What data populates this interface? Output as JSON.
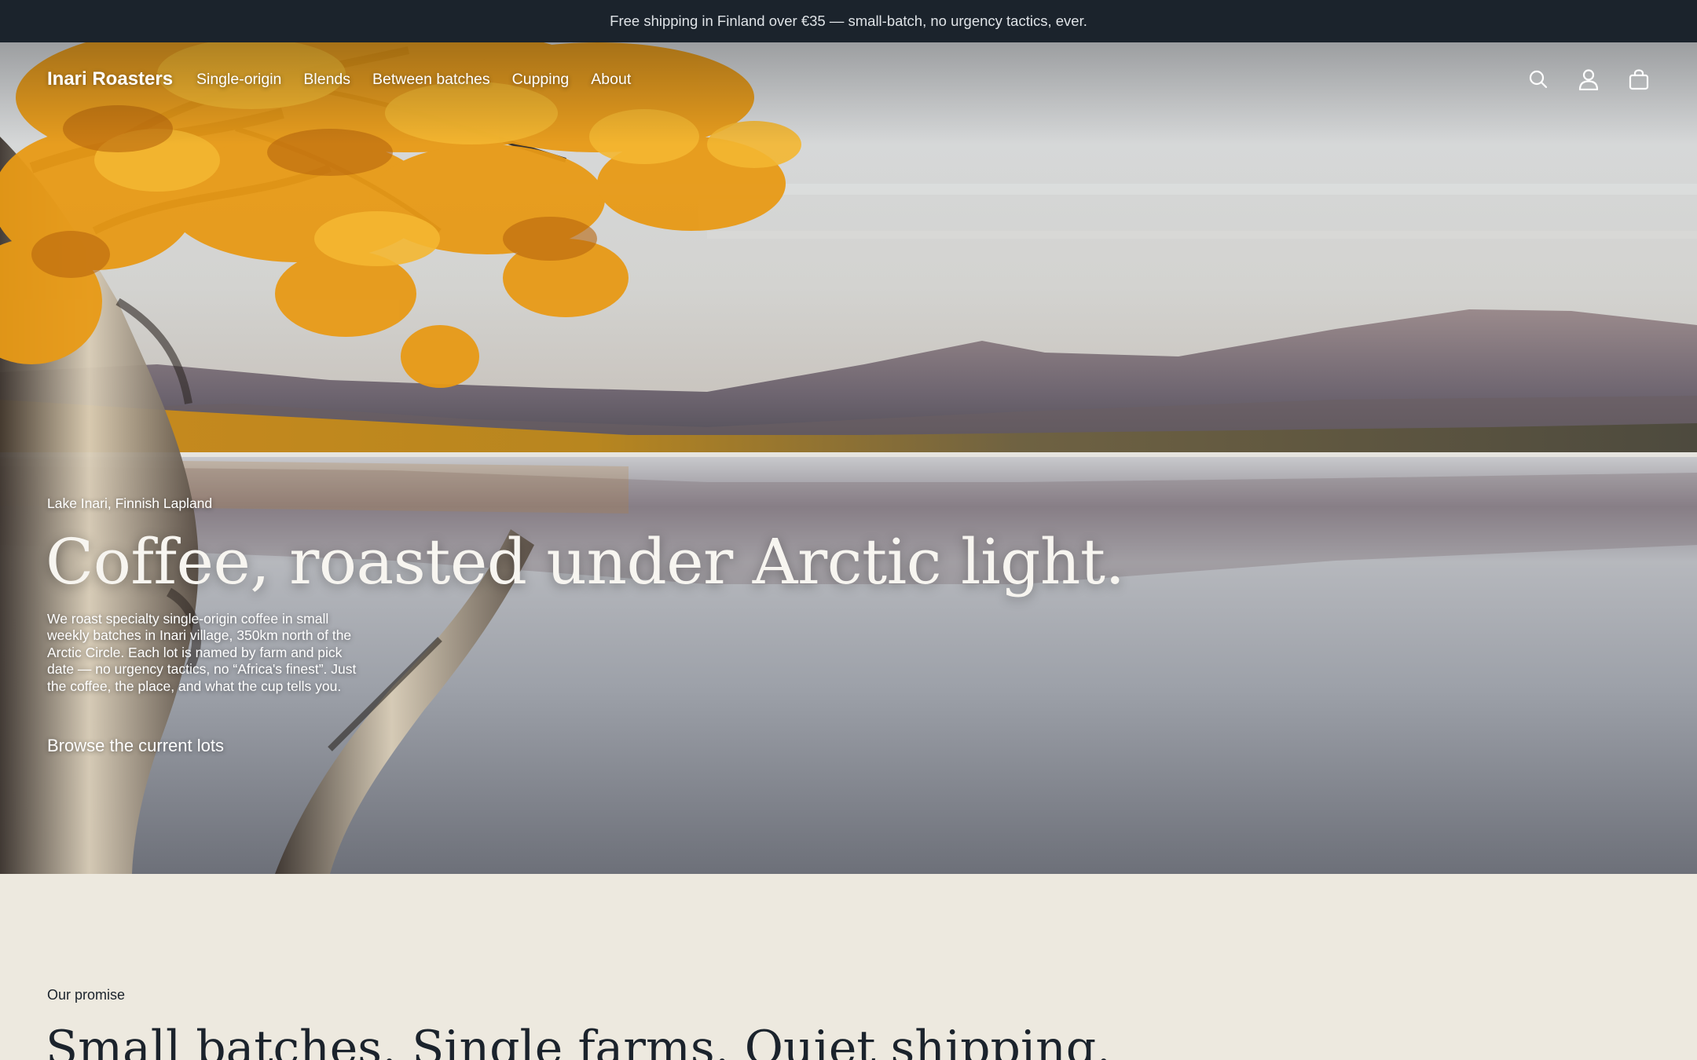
{
  "announcement": {
    "text": "Free shipping in Finland over €35 — small-batch, no urgency tactics, ever."
  },
  "header": {
    "brand": "Inari Roasters",
    "nav": [
      "Single-origin",
      "Blends",
      "Between batches",
      "Cupping",
      "About"
    ],
    "icons": [
      "search-icon",
      "account-icon",
      "cart-icon"
    ]
  },
  "hero": {
    "eyebrow": "Lake Inari, Finnish Lapland",
    "headline": "Coffee, roasted under Arctic light.",
    "body": "We roast specialty single-origin coffee in small weekly batches in Inari village, 350km north of the Arctic Circle. Each lot is named by farm and pick date — no urgency tactics, no “Africa's finest”. Just the coffee, the place, and what the cup tells you.",
    "cta": "Browse the current lots"
  },
  "promise": {
    "label": "Our promise",
    "heading": "Small batches. Single farms. Quiet shipping."
  },
  "colors": {
    "announcement_bg": "#1b232c",
    "page_bg": "#ede9df",
    "text_dark": "#1b232c",
    "foliage": "#e89a16"
  }
}
